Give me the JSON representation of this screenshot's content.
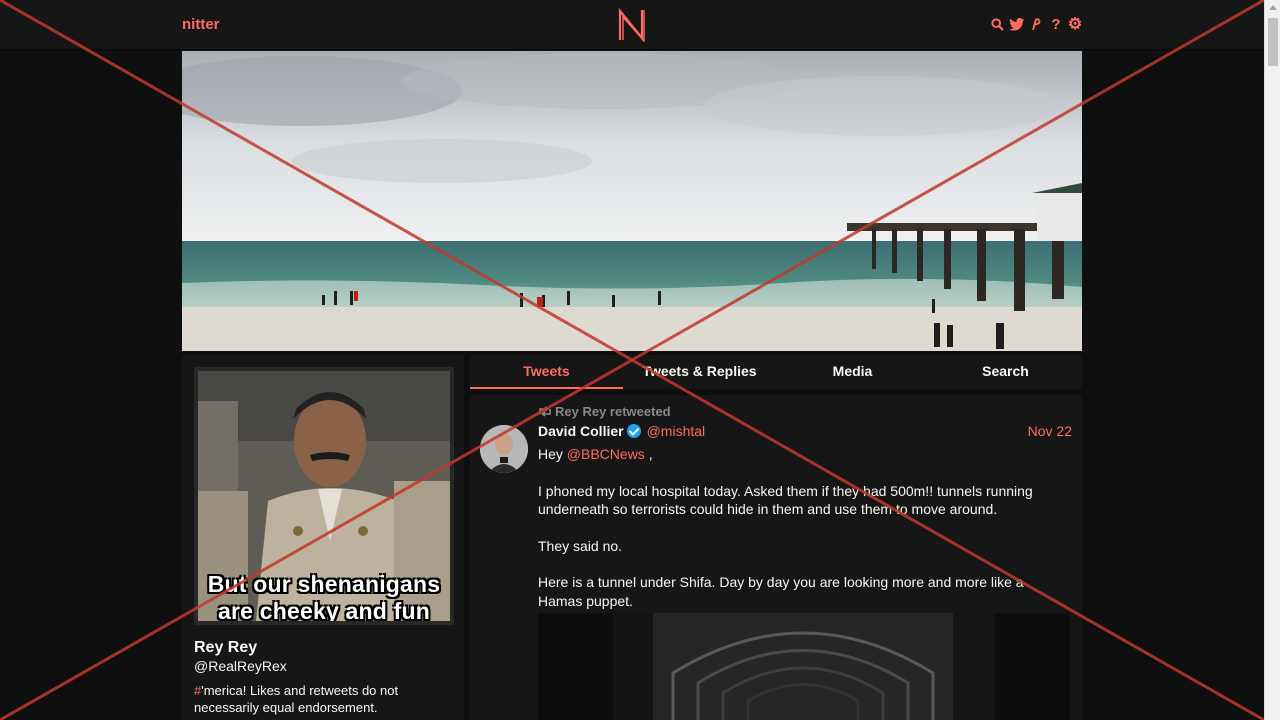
{
  "nav": {
    "brand": "nitter",
    "logo_letter": "N",
    "icons": [
      "search-icon",
      "twitter-icon",
      "rss-icon",
      "help-icon",
      "settings-icon"
    ],
    "help_glyph": "?",
    "settings_glyph": "⚙"
  },
  "profile": {
    "avatar_caption_line1": "But our shenanigans",
    "avatar_caption_line2": "are cheeky and fun",
    "fullname": "Rey Rey",
    "username": "@RealReyRex",
    "bio_hash": "#",
    "bio_text": "'merica! Likes and retweets do not necessarily equal endorsement."
  },
  "tabs": [
    {
      "label": "Tweets",
      "active": true
    },
    {
      "label": "Tweets & Replies",
      "active": false
    },
    {
      "label": "Media",
      "active": false
    },
    {
      "label": "Search",
      "active": false
    }
  ],
  "tweet": {
    "retweet_label": "Rey Rey retweeted",
    "fullname": "David Collier",
    "verified": true,
    "username": "@mishtal",
    "date": "Nov 22",
    "greeting": "Hey",
    "mention": "@BBCNews",
    "greeting_tail": " ,",
    "paragraphs": [
      "I phoned my local hospital today. Asked them if they had 500m!! tunnels running underneath so terrorists could hide in them and use them to move around.",
      "They said no.",
      "Here is a tunnel under Shifa. Day by day you are looking more and more like a Hamas puppet."
    ]
  },
  "colors": {
    "accent": "#ff6c60",
    "background": "#0f0f0f",
    "panel": "#161616",
    "text": "#f8f8f2",
    "muted": "#888889",
    "verified": "#1da1f2",
    "overlay_x": "#c0392b"
  }
}
